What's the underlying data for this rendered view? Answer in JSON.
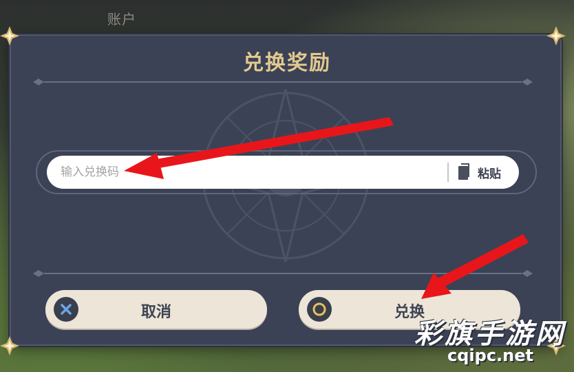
{
  "background": {
    "top_label": "账户"
  },
  "dialog": {
    "title": "兑换奖励",
    "input": {
      "placeholder": "输入兑换码",
      "value": ""
    },
    "paste_label": "粘贴",
    "cancel_label": "取消",
    "confirm_label": "兑换"
  },
  "watermark": {
    "cn": "彩旗手游网",
    "en": "cqipc.net"
  },
  "colors": {
    "dialog_bg": "#3b4255",
    "title_gold": "#e3c98f",
    "button_bg": "#ece5d8",
    "arrow_red": "#e8161a",
    "cancel_icon_blue": "#6aa6e6",
    "confirm_icon_gold": "#e8c25a"
  },
  "icons": [
    "clipboard-icon",
    "cross-icon",
    "ring-icon",
    "corner-ornament-icon",
    "star-divider-icon"
  ]
}
